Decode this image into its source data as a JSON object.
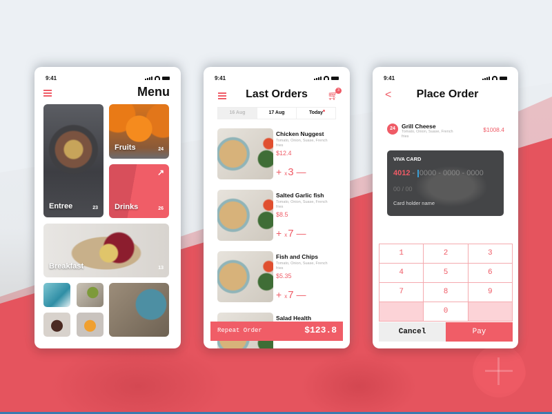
{
  "status_bar": {
    "time": "9:41"
  },
  "menu_screen": {
    "title": "Menu",
    "categories": [
      {
        "label": "Entree",
        "count": "23"
      },
      {
        "label": "Fruits",
        "count": "24"
      },
      {
        "label": "Drinks",
        "count": "26"
      },
      {
        "label": "Breakfast",
        "count": "13"
      }
    ],
    "drinks_icon": "↗"
  },
  "orders_screen": {
    "title": "Last Orders",
    "cart_count": "3",
    "date_tabs": [
      "16 Aug",
      "17 Aug",
      "Today"
    ],
    "items": [
      {
        "name": "Chicken Nuggest",
        "desc": "Tomato, Onion, Suase, French fries",
        "price": "$12.4",
        "qty_prefix": "x",
        "qty": "3"
      },
      {
        "name": "Salted Garlic fish",
        "desc": "Tomato, Onion, Suase, French fries",
        "price": "$8.5",
        "qty_prefix": "x",
        "qty": "7"
      },
      {
        "name": "Fish and Chips",
        "desc": "Tomato, Onion, Suase, French fries",
        "price": "$5.35",
        "qty_prefix": "x",
        "qty": "7"
      },
      {
        "name": "Salad Health"
      }
    ],
    "plus": "+",
    "minus": "—",
    "repeat_label": "Repeat Order",
    "total": "$123.8"
  },
  "place_screen": {
    "title": "Place Order",
    "back_icon": "<",
    "item": {
      "badge": "24",
      "name": "Grill Cheese",
      "desc": "Tomato, Onion, Suase, French fries",
      "price": "$1008.4"
    },
    "card": {
      "brand": "VIVA CARD",
      "number_first": "4012",
      "number_sep": " - ",
      "number_rest": "0000 - 0000 - 0000",
      "expiry_placeholder": "00 / 00",
      "holder_placeholder": "Card holder name"
    },
    "keypad": [
      "1",
      "2",
      "3",
      "4",
      "5",
      "6",
      "7",
      "8",
      "9",
      "",
      "0",
      ""
    ],
    "cancel_label": "Cancel",
    "pay_label": "Pay"
  },
  "colors": {
    "accent": "#ef5b66",
    "card_bg": "#444547",
    "background": "#ecf0f4"
  }
}
